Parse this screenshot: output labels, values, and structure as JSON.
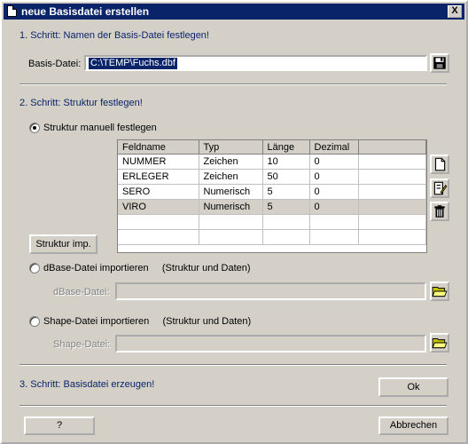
{
  "window": {
    "title": "neue Basisdatei erstellen",
    "close_glyph": "X"
  },
  "step1": {
    "heading": "1. Schritt:   Namen der Basis-Datei festlegen!",
    "label": "Basis-Datei:",
    "value": "C:\\TEMP\\Fuchs.dbf",
    "save_icon": "floppy-disk-icon"
  },
  "step2": {
    "heading": "2. Schritt:   Struktur festlegen!",
    "manual_radio": "Struktur manuell festlegen",
    "manual_checked": true,
    "table": {
      "columns": [
        "Feldname",
        "Typ",
        "Länge",
        "Dezimal",
        ""
      ],
      "rows": [
        [
          "NUMMER",
          "Zeichen",
          "10",
          "0",
          ""
        ],
        [
          "ERLEGER",
          "Zeichen",
          "50",
          "0",
          ""
        ],
        [
          "SERO",
          "Numerisch",
          "5",
          "0",
          ""
        ],
        [
          "VIRO",
          "Numerisch",
          "5",
          "0",
          ""
        ],
        [
          "",
          "",
          "",
          "",
          ""
        ],
        [
          "",
          "",
          "",
          "",
          ""
        ]
      ],
      "selected_row": 3
    },
    "import_button": "Struktur imp.",
    "side_icons": [
      "new-document-icon",
      "edit-document-icon",
      "trash-icon"
    ],
    "dbase_radio": "dBase-Datei importieren     (Struktur und Daten)",
    "dbase_label": "dBase-Datei:",
    "dbase_value": "",
    "shape_radio": "Shape-Datei importieren     (Struktur und Daten)",
    "shape_label": "Shape-Datei:",
    "shape_value": "",
    "folder_icon": "open-folder-icon"
  },
  "step3": {
    "heading": "3. Schritt:   Basisdatei erzeugen!",
    "ok_button": "Ok"
  },
  "footer": {
    "help_button": "?",
    "cancel_button": "Abbrechen"
  },
  "colors": {
    "titlebar": "#0a246a",
    "face": "#d4d0c8",
    "step_text": "#0a246a"
  }
}
